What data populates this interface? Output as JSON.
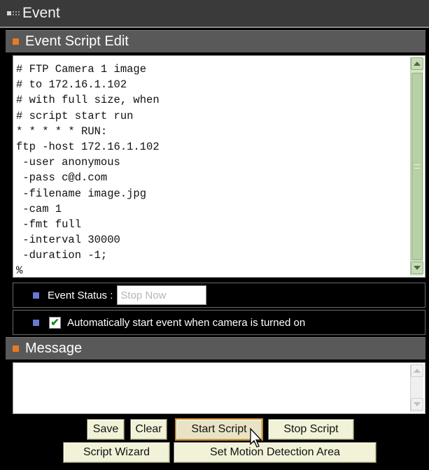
{
  "window": {
    "title": "Event"
  },
  "script_section": {
    "title": "Event Script Edit",
    "lines": [
      "# FTP Camera 1 image",
      "# to 172.16.1.102",
      "# with full size, when",
      "# script start run",
      "* * * * * RUN:",
      "ftp -host 172.16.1.102",
      " -user anonymous",
      " -pass c@d.com",
      " -filename image.jpg",
      " -cam 1",
      " -fmt full",
      " -interval 30000",
      " -duration -1;",
      "%"
    ]
  },
  "event_status": {
    "label": "Event Status :",
    "value": "Stop Now"
  },
  "auto_start": {
    "label": "Automatically start event when camera is turned on",
    "checked": true
  },
  "message_section": {
    "title": "Message",
    "text": ""
  },
  "buttons": {
    "save": "Save",
    "clear": "Clear",
    "start_script": "Start Script",
    "stop_script": "Stop Script",
    "script_wizard": "Script Wizard",
    "set_motion": "Set Motion Detection Area"
  },
  "colors": {
    "section_bullet": "#ec7a1f",
    "row_bullet": "#6b78d6",
    "button_face": "#f2f2d8",
    "scrollbar": "#d6e5c6"
  }
}
